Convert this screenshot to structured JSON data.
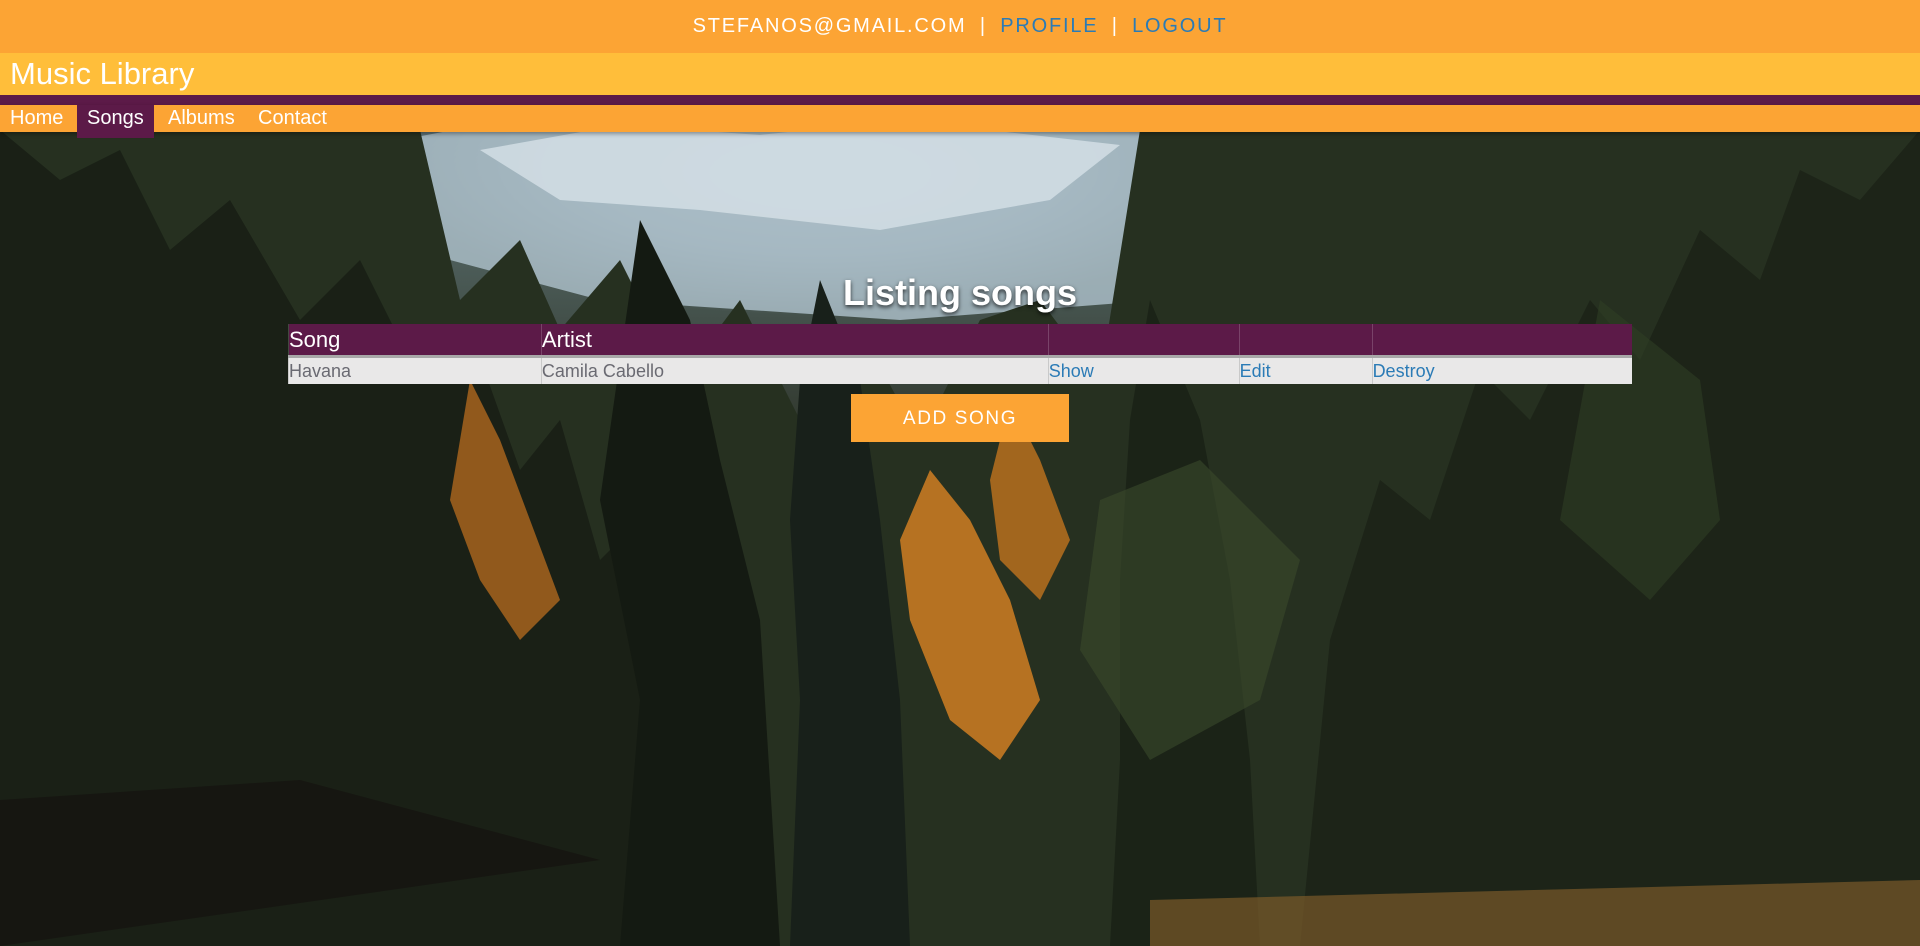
{
  "topbar": {
    "email": "STEFANOS@GMAIL.COM",
    "separator": "|",
    "profile_link": "PROFILE",
    "logout_link": "LOGOUT"
  },
  "header": {
    "title": "Music Library"
  },
  "nav": {
    "items": [
      {
        "label": "Home",
        "active": false
      },
      {
        "label": "Songs",
        "active": true
      },
      {
        "label": "Albums",
        "active": false
      },
      {
        "label": "Contact",
        "active": false
      }
    ]
  },
  "main": {
    "heading": "Listing songs",
    "table": {
      "columns": [
        "Song",
        "Artist",
        "",
        "",
        ""
      ],
      "rows": [
        {
          "song": "Havana",
          "artist": "Camila Cabello",
          "show": "Show",
          "edit": "Edit",
          "destroy": "Destroy"
        }
      ]
    },
    "add_button": "ADD SONG"
  },
  "colors": {
    "topbar": "#fca434",
    "titlebar": "#ffbe3a",
    "accent_purple": "#5c1a48",
    "link_blue": "#2b7bb6",
    "row_background": "#e9e8e8"
  },
  "background": {
    "description_icon": "forest-mountain-photo"
  }
}
